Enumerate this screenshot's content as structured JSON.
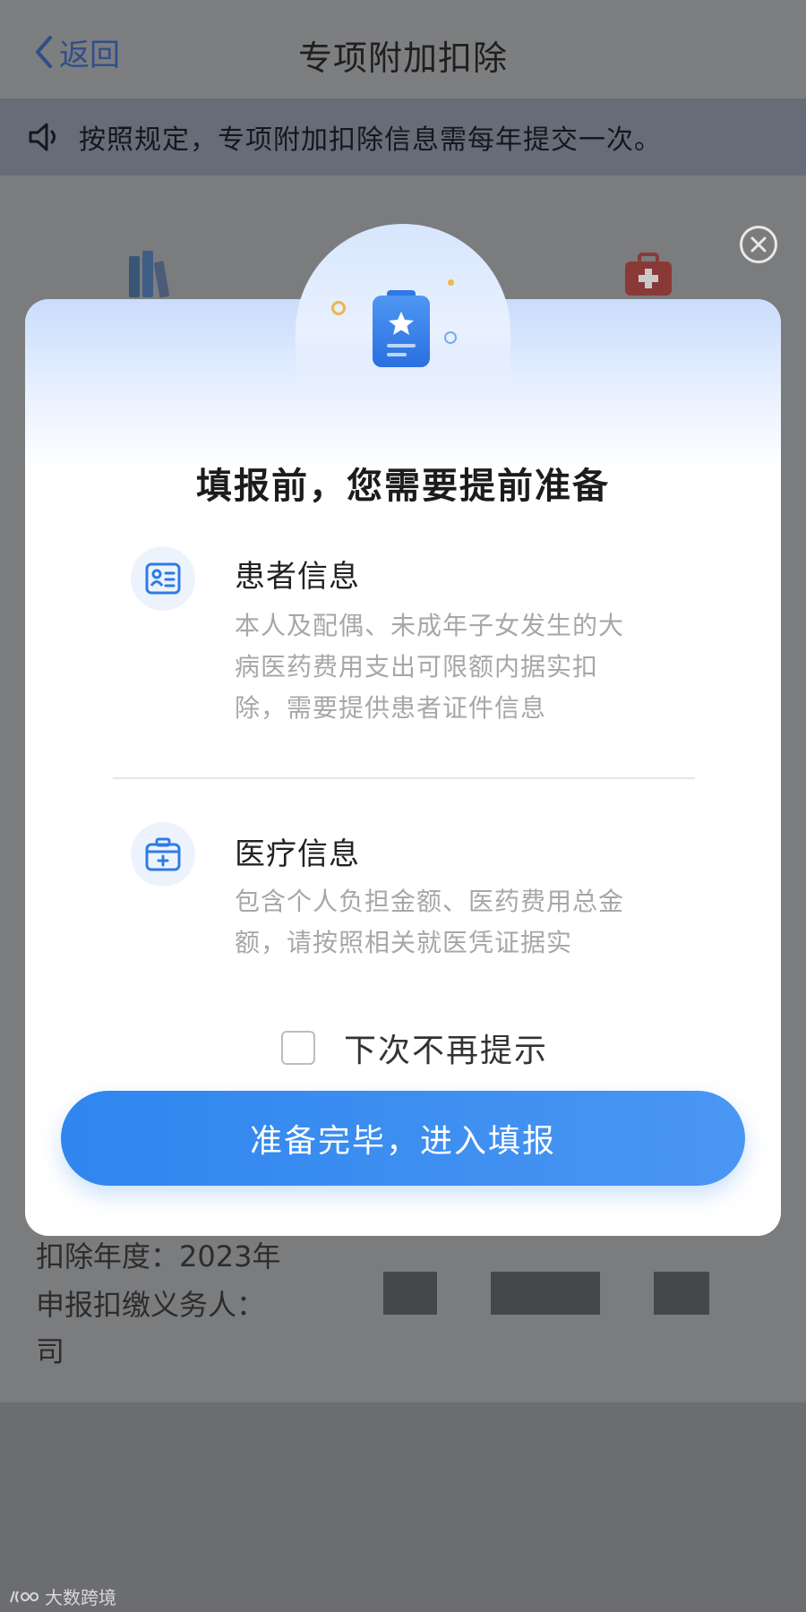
{
  "nav": {
    "back_label": "返回",
    "title": "专项附加扣除"
  },
  "notice": {
    "text": "按照规定，专项附加扣除信息需每年提交一次。"
  },
  "background_info": {
    "year_line": "扣除年度：2023年",
    "agent_line": "申报扣缴义务人：",
    "agent_line2": "司"
  },
  "modal": {
    "title": "填报前，您需要提前准备",
    "items": [
      {
        "title": "患者信息",
        "description": "本人及配偶、未成年子女发生的大病医药费用支出可限额内据实扣除，需要提供患者证件信息"
      },
      {
        "title": "医疗信息",
        "description": "包含个人负担金额、医药费用总金额，请按照相关就医凭证据实"
      }
    ],
    "dont_show_label": "下次不再提示",
    "primary_button": "准备完毕，进入填报"
  },
  "watermark": "大数跨境",
  "colors": {
    "accent": "#2f86ee",
    "icon_blue": "#2f7be6"
  }
}
